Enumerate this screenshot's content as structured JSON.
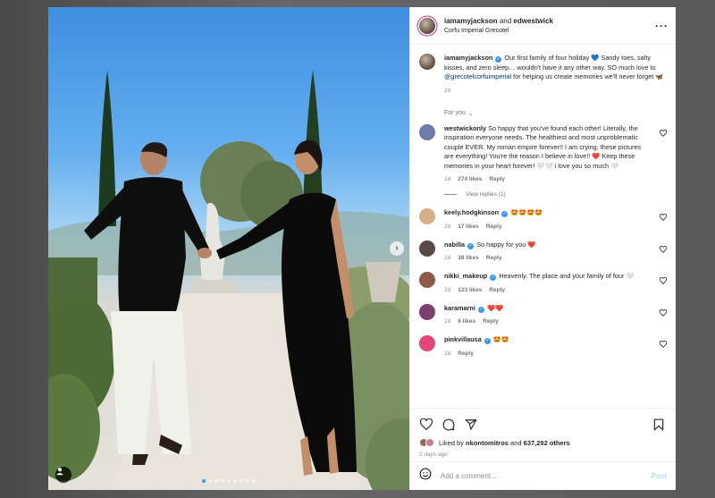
{
  "post": {
    "header": {
      "user": "iamamyjackson",
      "connector": "and",
      "collaborator": "edwestwick",
      "location": "Corfu Imperial Grecotel",
      "more_icon": "more-horizontal-icon"
    },
    "caption": {
      "user": "iamamyjackson",
      "text_before_mention": "Our first family of four holiday 💙 Sandy toes, salty kisses, and zero sleep… wouldn't have it any other way. SO much love to ",
      "mention": "@grecotelcorfuimperial",
      "text_after_mention": " for helping us create memories we'll never forget 🦋",
      "time": "2d"
    },
    "for_you_label": "For you"
  },
  "comments": [
    {
      "user": "westwickonly",
      "verified": false,
      "text": "So happy that you've found each other! Literally, the inspiration everyone needs. The healthiest and most unproblematic couple EVER. My roman empire forever!! I am crying, these pictures are everything! You're the reason I believe in love!! ❤️ Keep these memories in your heart forever! 🤍🤍 i love you so much 🤍",
      "time": "2d",
      "likes": "274 likes",
      "reply": "Reply",
      "view_replies": "View replies (1)"
    },
    {
      "user": "keely.hodgkinson",
      "verified": true,
      "text": "🤩🤩🤩🤩",
      "time": "2d",
      "likes": "17 likes",
      "reply": "Reply"
    },
    {
      "user": "nabilla",
      "verified": true,
      "text": "So happy for you ❤️",
      "time": "2d",
      "likes": "38 likes",
      "reply": "Reply"
    },
    {
      "user": "nikki_makeup",
      "verified": true,
      "text": "Heavenly. The place and your family of four 🤍",
      "time": "2d",
      "likes": "123 likes",
      "reply": "Reply"
    },
    {
      "user": "karamarni",
      "verified": true,
      "text": "❤️❤️",
      "time": "2d",
      "likes": "6 likes",
      "reply": "Reply"
    },
    {
      "user": "pinkvillausa",
      "verified": true,
      "text": "🤩🤩",
      "time": "2d",
      "likes": "",
      "reply": "Reply"
    }
  ],
  "engagement": {
    "liked_by_prefix": "Liked by",
    "liked_by_user": "nkontomitros",
    "and_word": "and",
    "others_count": "637,292 others",
    "date": "2 days ago"
  },
  "composer": {
    "placeholder": "Add a comment...",
    "post_label": "Post"
  },
  "colors": {
    "accent": "#3897f0",
    "post_disabled": "#b2dffc",
    "heart_red": "#ed4956"
  },
  "carousel": {
    "dot_count": 9,
    "active_index": 0
  }
}
